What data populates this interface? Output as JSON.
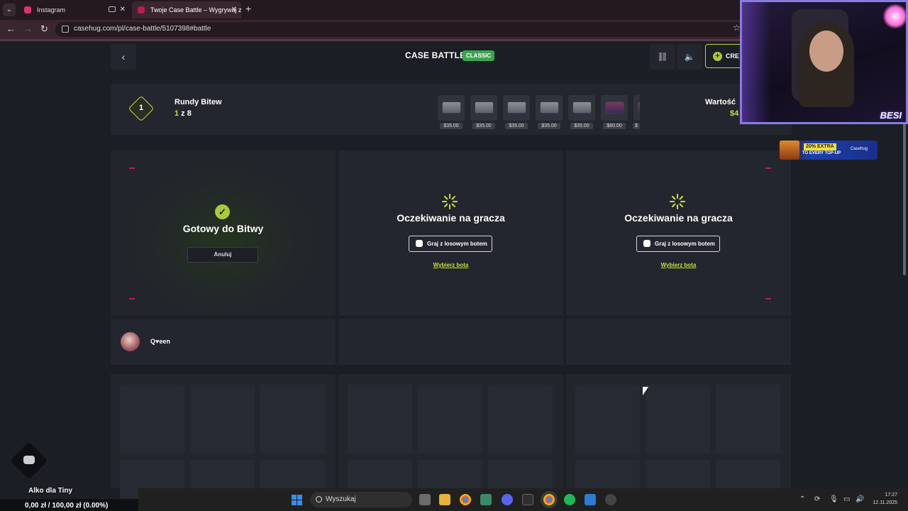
{
  "browser": {
    "tabs": [
      {
        "label": "Instagram",
        "favicon_color": "#e1306c"
      },
      {
        "label": "Twoje Case Battle – Wygrywaj z",
        "favicon_color": "#c21b4b"
      }
    ],
    "new_tab": "+",
    "url": "casehug.com/pl/case-battle/5107398#battle"
  },
  "header": {
    "title": "CASE BATTLE",
    "badge": "CLASSIC",
    "create_label": "CRE"
  },
  "rounds": {
    "current_round": "1",
    "label": "Rundy Bitew",
    "current": "1",
    "separator": " z 8",
    "value_label": "Wartość",
    "value_amount": "$4",
    "cases": [
      {
        "price": "$35.00",
        "style": "grey"
      },
      {
        "price": "$35.00",
        "style": "grey"
      },
      {
        "price": "$35.00",
        "style": "grey"
      },
      {
        "price": "$35.00",
        "style": "grey"
      },
      {
        "price": "$35.00",
        "style": "grey"
      },
      {
        "price": "$80.00",
        "style": "red"
      },
      {
        "price": "$",
        "style": "red"
      }
    ]
  },
  "slots": {
    "ready": {
      "text": "Gotowy do Bitwy",
      "cancel": "Anuluj"
    },
    "waiting": [
      {
        "text": "Oczekiwanie na gracza",
        "bot_button": "Graj z losowym botem",
        "choose_bot": "Wybierz bota"
      },
      {
        "text": "Oczekiwanie na gracza",
        "bot_button": "Graj z losowym botem",
        "choose_bot": "Wybierz bota"
      }
    ]
  },
  "player": {
    "name": "Q♥een"
  },
  "stream": {
    "cam_tag": "BESI",
    "promo_line1": "20% EXTRA",
    "promo_line2": "TO EVERY TOP-UP",
    "promo_logo": "Casehug",
    "goal_title": "Alko dla Tiny",
    "goal_progress": "0,00 zł / 100,00 zł (0.00%)",
    "goal_fraction": 0.0
  },
  "taskbar": {
    "search_placeholder": "Wyszukaj",
    "time": "17:27",
    "date": "12.11.2025"
  },
  "colors": {
    "accent": "#c4e03a",
    "badge": "#3aa54f",
    "corner": "#c21b4b"
  }
}
